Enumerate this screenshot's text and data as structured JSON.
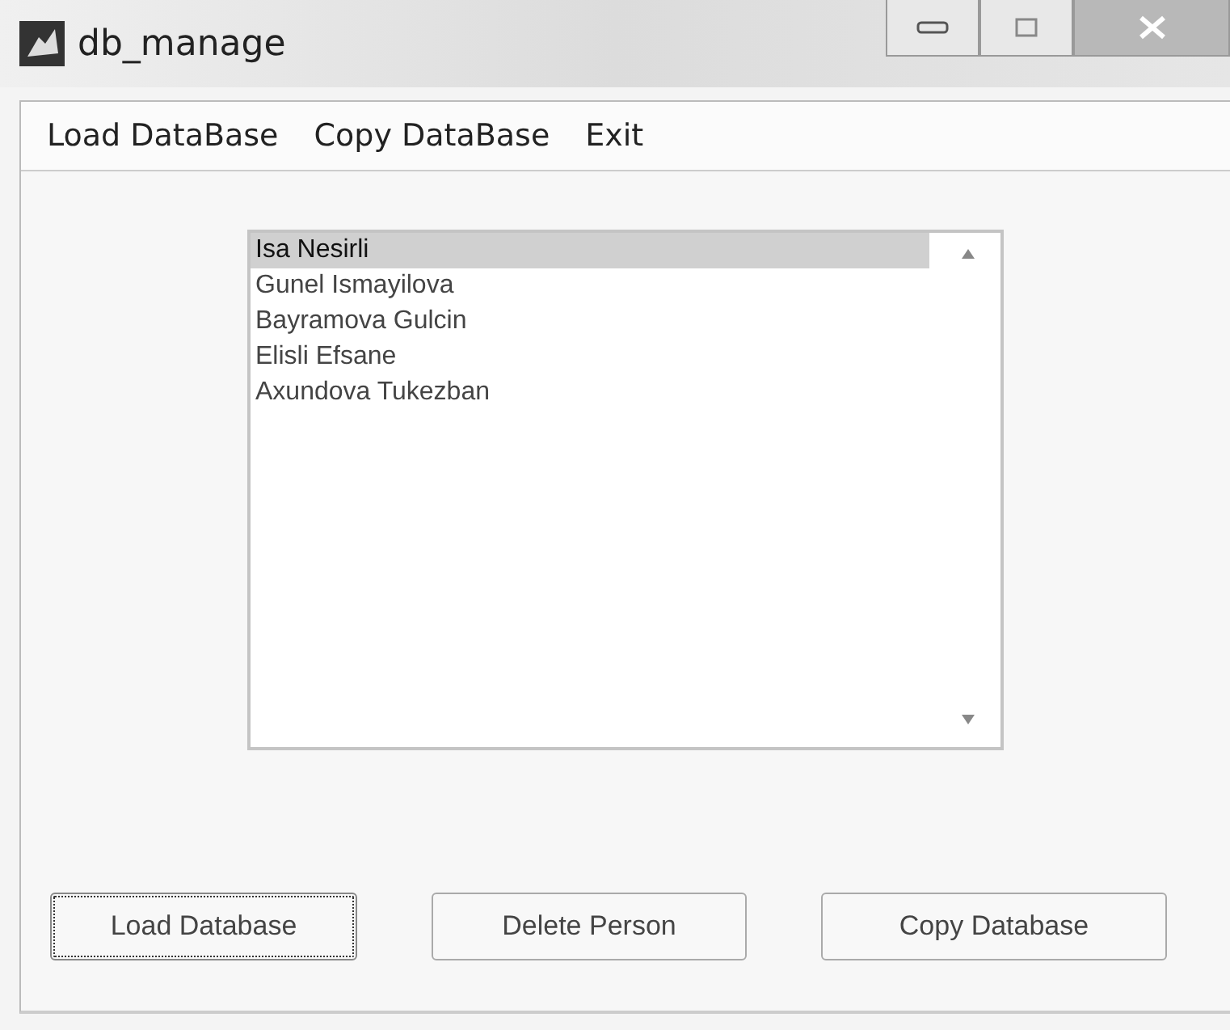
{
  "window": {
    "title": "db_manage"
  },
  "menu": [
    {
      "label": "Load DataBase"
    },
    {
      "label": "Copy DataBase"
    },
    {
      "label": "Exit"
    }
  ],
  "listbox": {
    "items": [
      {
        "label": "Isa Nesirli",
        "selected": true
      },
      {
        "label": "Gunel Ismayilova",
        "selected": false
      },
      {
        "label": "Bayramova Gulcin",
        "selected": false
      },
      {
        "label": "Elisli Efsane",
        "selected": false
      },
      {
        "label": "Axundova Tukezban",
        "selected": false
      }
    ]
  },
  "buttons": [
    {
      "label": "Load Database",
      "focused": true
    },
    {
      "label": "Delete Person",
      "focused": false
    },
    {
      "label": "Copy Database",
      "focused": false
    }
  ]
}
